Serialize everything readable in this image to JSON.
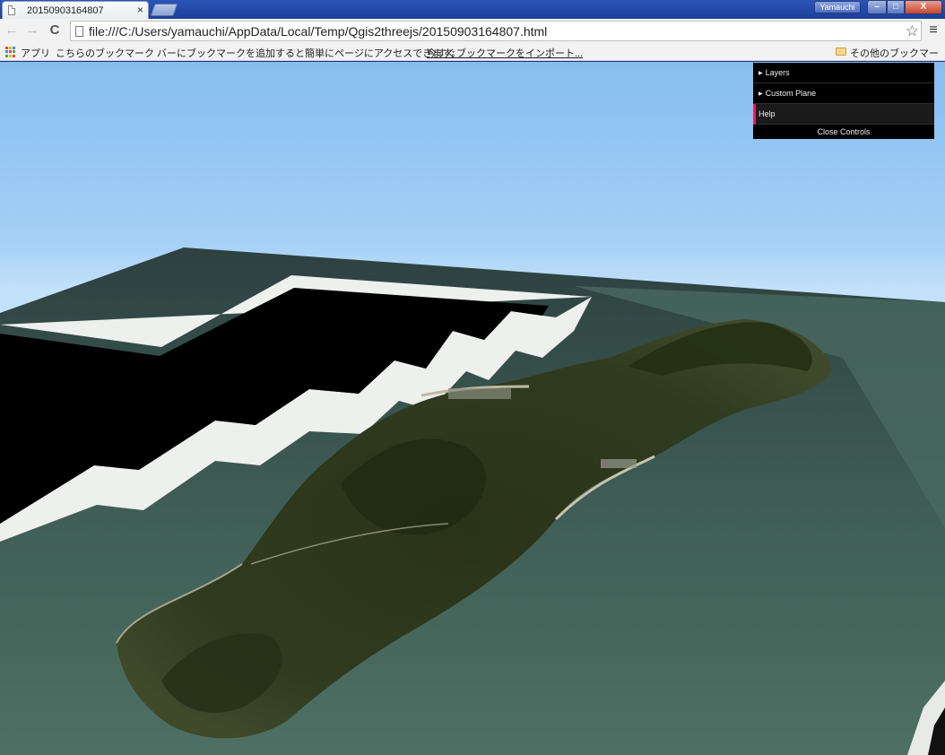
{
  "browser": {
    "tab_title": "20150903164807",
    "tab_close_glyph": "×",
    "profile_name": "Yamauchi",
    "url": "file:///C:/Users/yamauchi/AppData/Local/Temp/Qgis2threejs/20150903164807.html",
    "icons": {
      "back": "←",
      "forward": "→",
      "reload": "C",
      "star": "☆",
      "menu": "≡",
      "minimize": "–",
      "maximize": "□",
      "close": "X"
    }
  },
  "bookmarks": {
    "apps_label": "アプリ",
    "hint_text": "こちらのブックマーク バーにブックマークを追加すると簡単にページにアクセスできます。",
    "import_link": "今すぐブックマークをインポート...",
    "other_bookmarks": "その他のブックマーク"
  },
  "controls": {
    "layers_label": "Layers",
    "custom_plane_label": "Custom Plane",
    "help_label": "Help",
    "close_label": "Close Controls",
    "accent_color": "#e61d5f"
  },
  "colors": {
    "sky_top": "#86bdf0",
    "water": "#3d5a52",
    "land": "#2e3a1e"
  }
}
